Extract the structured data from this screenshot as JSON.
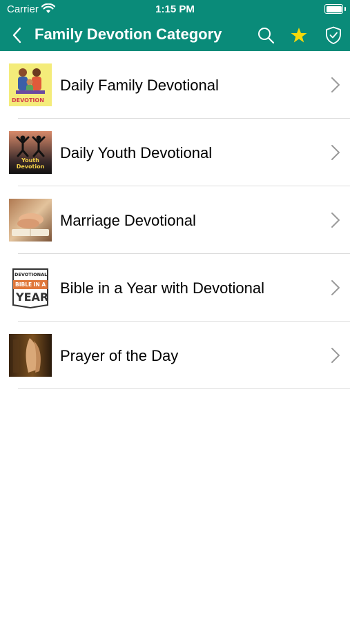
{
  "status_bar": {
    "carrier": "Carrier",
    "time": "1:15 PM"
  },
  "navbar": {
    "title": "Family Devotion Category",
    "icons": [
      "back-chevron-icon",
      "search-icon",
      "star-icon",
      "shield-check-icon"
    ],
    "background_color": "#0a8b79",
    "star_color": "#f5d90a"
  },
  "items": [
    {
      "label": "Daily Family Devotional",
      "thumb_text": "DEVOTION"
    },
    {
      "label": "Daily Youth Devotional",
      "thumb_text": "Youth Devotion"
    },
    {
      "label": "Marriage Devotional"
    },
    {
      "label": "Bible in a Year with Devotional",
      "thumb_text_top": "DEVOTIONAL",
      "thumb_text_mid": "BIBLE IN A",
      "thumb_text_bottom": "YEAR"
    },
    {
      "label": "Prayer of the Day"
    }
  ]
}
